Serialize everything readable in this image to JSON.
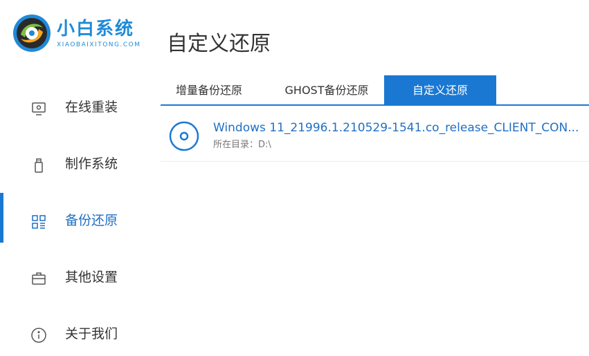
{
  "brand": {
    "name_cn": "小白系统",
    "name_en": "XIAOBAIXITONG.COM"
  },
  "page": {
    "title": "自定义还原"
  },
  "sidebar": {
    "items": [
      {
        "label": "在线重装",
        "icon": "monitor-icon",
        "active": false
      },
      {
        "label": "制作系统",
        "icon": "usb-drive-icon",
        "active": false
      },
      {
        "label": "备份还原",
        "icon": "grid-icon",
        "active": true
      },
      {
        "label": "其他设置",
        "icon": "briefcase-icon",
        "active": false
      },
      {
        "label": "关于我们",
        "icon": "info-icon",
        "active": false
      }
    ]
  },
  "tabs": [
    {
      "label": "增量备份还原",
      "active": false
    },
    {
      "label": "GHOST备份还原",
      "active": false
    },
    {
      "label": "自定义还原",
      "active": true
    }
  ],
  "files": [
    {
      "name": "Windows 11_21996.1.210529-1541.co_release_CLIENT_CON...",
      "path": "所在目录：D:\\",
      "icon": "disc-icon"
    }
  ],
  "colors": {
    "accent": "#1a78d2",
    "link": "#1f6fc4",
    "text": "#333333",
    "muted": "#777777"
  }
}
